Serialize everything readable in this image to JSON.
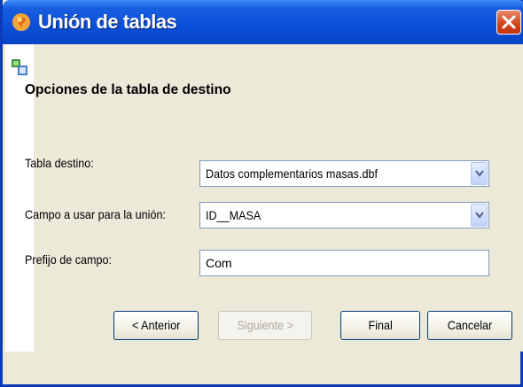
{
  "window": {
    "title": "Unión de tablas",
    "colors": {
      "titlebar": "#0a4fd8",
      "frame": "#0a3bb8",
      "body": "#ece9d8",
      "close": "#d3421a"
    },
    "icons": {
      "app": "globe-icon",
      "close": "close-icon",
      "wizard": "layers-icon"
    }
  },
  "section": {
    "title": "Opciones de la tabla de destino"
  },
  "fields": {
    "tabla_destino": {
      "label": "Tabla destino:",
      "value": "Datos complementarios masas.dbf"
    },
    "campo_union": {
      "label": "Campo a usar para la unión:",
      "value": "ID__MASA"
    },
    "prefijo": {
      "label": "Prefijo de campo:",
      "value": "Com"
    }
  },
  "buttons": {
    "anterior": "< Anterior",
    "siguiente": "Siguiente >",
    "final": "Final",
    "cancelar": "Cancelar"
  }
}
